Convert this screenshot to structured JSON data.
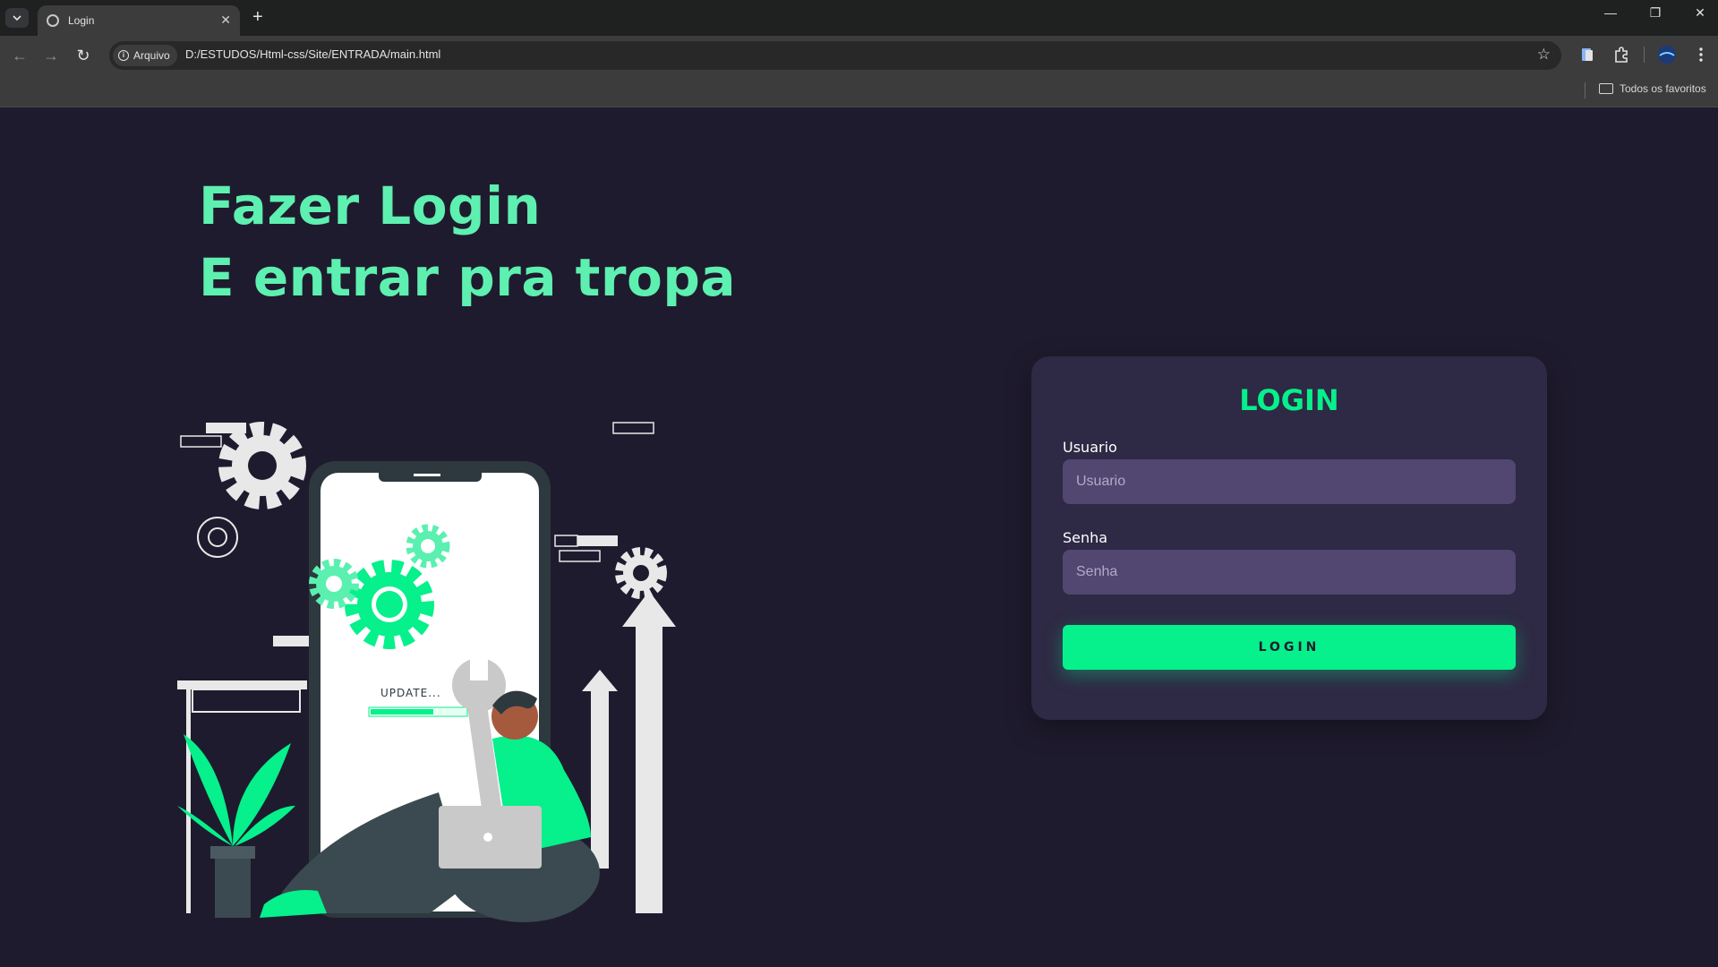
{
  "browser": {
    "tab_title": "Login",
    "new_tab_symbol": "+",
    "security_chip": "Arquivo",
    "url": "D:/ESTUDOS/Html-css/Site/ENTRADA/main.html",
    "bookmarks_all": "Todos os favoritos"
  },
  "page": {
    "headline_line1": "Fazer Login",
    "headline_line2": "E entrar pra tropa",
    "illustration": {
      "update_text": "UPDATE..."
    }
  },
  "login_form": {
    "title": "LOGIN",
    "username_label": "Usuario",
    "username_placeholder": "Usuario",
    "username_value": "",
    "password_label": "Senha",
    "password_placeholder": "Senha",
    "password_value": "",
    "submit_label": "LOGIN"
  },
  "colors": {
    "background": "#1f1b2e",
    "accent": "#06f08b",
    "headline": "#5ef0b0",
    "card": "#2e2944",
    "input": "#514770"
  }
}
